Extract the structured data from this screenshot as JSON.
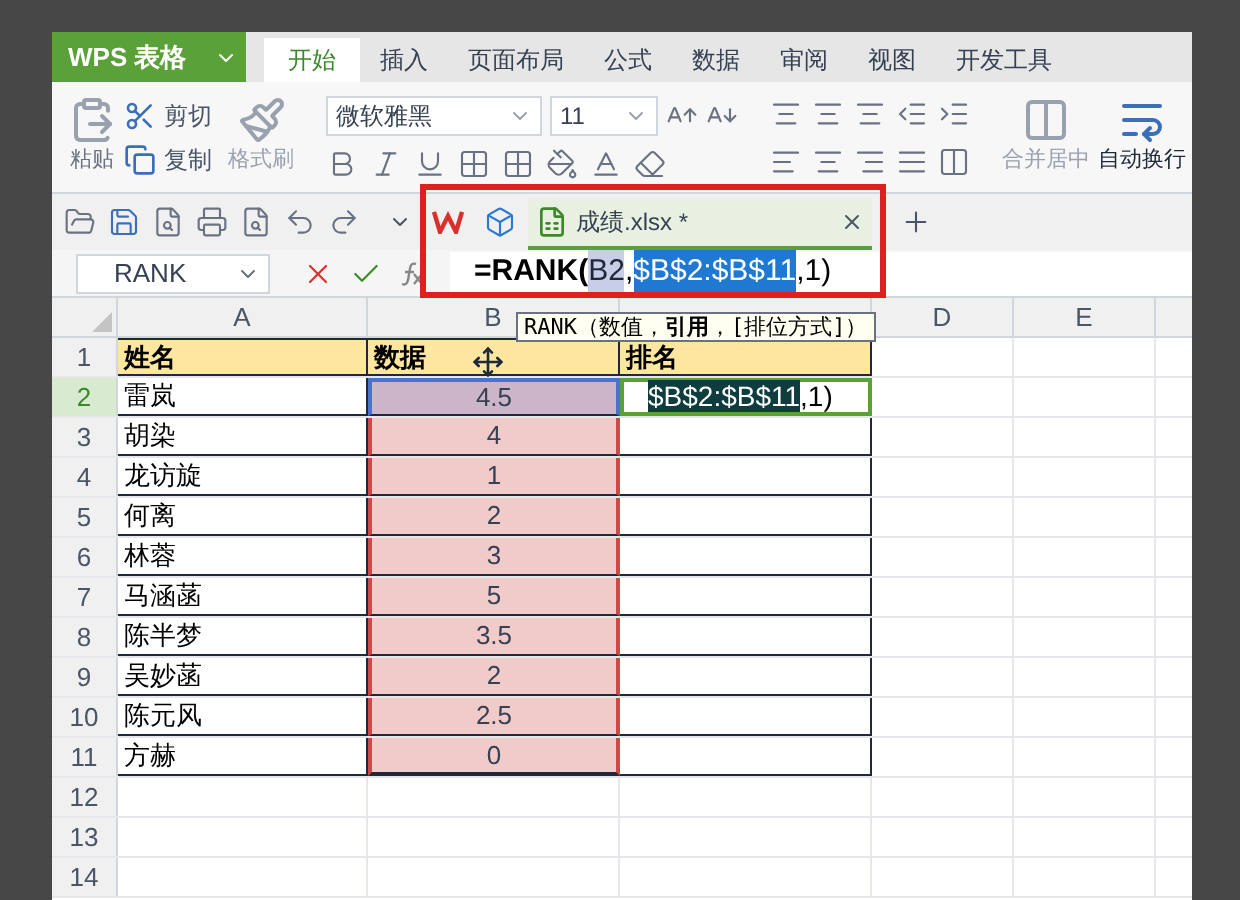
{
  "app": {
    "name": "WPS 表格"
  },
  "tabs": [
    {
      "label": "开始",
      "selected": true
    },
    {
      "label": "插入",
      "selected": false
    },
    {
      "label": "页面布局",
      "selected": false
    },
    {
      "label": "公式",
      "selected": false
    },
    {
      "label": "数据",
      "selected": false
    },
    {
      "label": "审阅",
      "selected": false
    },
    {
      "label": "视图",
      "selected": false
    },
    {
      "label": "开发工具",
      "selected": false
    }
  ],
  "ribbon": {
    "paste": "粘贴",
    "cut": "剪切",
    "copy": "复制",
    "format_painter": "格式刷",
    "font": "微软雅黑",
    "font_size": "11",
    "merge": "合并居中",
    "wrap": "自动换行"
  },
  "file_tab": {
    "title": "成绩.xlsx *"
  },
  "formula_bar": {
    "name_box": "RANK",
    "formula": [
      {
        "text": "=RANK(",
        "kind": "func"
      },
      {
        "text": "B2",
        "kind": "ref"
      },
      {
        "text": ",",
        "kind": "plain"
      },
      {
        "text": "$B$2:$B$11",
        "kind": "range"
      },
      {
        "text": ",1)",
        "kind": "plain"
      }
    ]
  },
  "tooltip": "RANK（数值，**引用**，[排位方式]）",
  "columns": [
    {
      "label": "A"
    },
    {
      "label": "B"
    },
    {
      "label": "D"
    },
    {
      "label": "E"
    }
  ],
  "rows": [
    {
      "num": "1",
      "kind": "header",
      "active": false,
      "name": "姓名",
      "value": "数据",
      "rank": "排名"
    },
    {
      "num": "2",
      "kind": "data",
      "active": true,
      "name": "雷岚",
      "value": "4.5",
      "ref": true,
      "editing": [
        {
          "text": "$B$2:$B$11",
          "kind": "range"
        },
        {
          "text": ",1)",
          "kind": "plain"
        }
      ]
    },
    {
      "num": "3",
      "kind": "data",
      "active": false,
      "name": "胡染",
      "value": "4",
      "in_range": true
    },
    {
      "num": "4",
      "kind": "data",
      "active": false,
      "name": "龙访旋",
      "value": "1",
      "in_range": true
    },
    {
      "num": "5",
      "kind": "data",
      "active": false,
      "name": "何离",
      "value": "2",
      "in_range": true
    },
    {
      "num": "6",
      "kind": "data",
      "active": false,
      "name": "林蓉",
      "value": "3",
      "in_range": true
    },
    {
      "num": "7",
      "kind": "data",
      "active": false,
      "name": "马涵菡",
      "value": "5",
      "in_range": true
    },
    {
      "num": "8",
      "kind": "data",
      "active": false,
      "name": "陈半梦",
      "value": "3.5",
      "in_range": true
    },
    {
      "num": "9",
      "kind": "data",
      "active": false,
      "name": "吴妙菡",
      "value": "2",
      "in_range": true
    },
    {
      "num": "10",
      "kind": "data",
      "active": false,
      "name": "陈元风",
      "value": "2.5",
      "in_range": true
    },
    {
      "num": "11",
      "kind": "data",
      "active": false,
      "name": "方赫",
      "value": "0",
      "in_range": true
    },
    {
      "num": "12",
      "kind": "empty",
      "active": false
    },
    {
      "num": "13",
      "kind": "empty",
      "active": false
    },
    {
      "num": "14",
      "kind": "empty",
      "active": false
    }
  ]
}
